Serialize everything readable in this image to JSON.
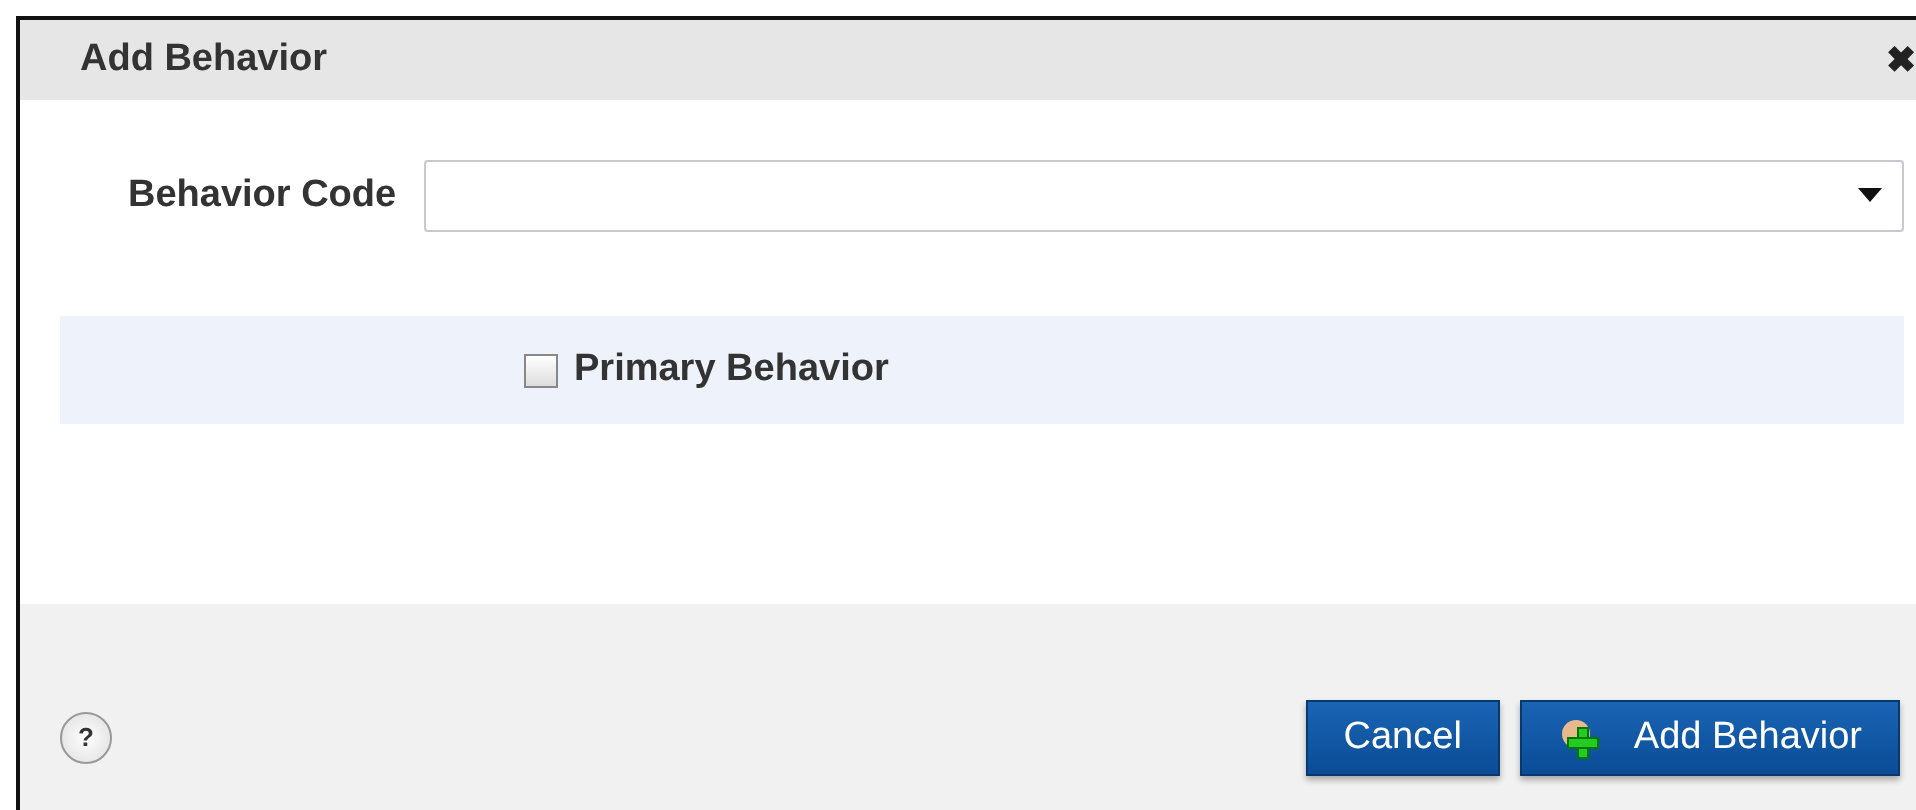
{
  "dialog": {
    "title": "Add Behavior",
    "close": "✖"
  },
  "fields": {
    "behavior_code": {
      "label": "Behavior Code"
    },
    "primary_behavior": {
      "label": "Primary Behavior",
      "checked": false
    }
  },
  "footer": {
    "help": "?",
    "buttons": [
      {
        "label": "Cancel",
        "kind": "plain"
      },
      {
        "label": "Add Behavior",
        "kind": "icon"
      }
    ]
  }
}
